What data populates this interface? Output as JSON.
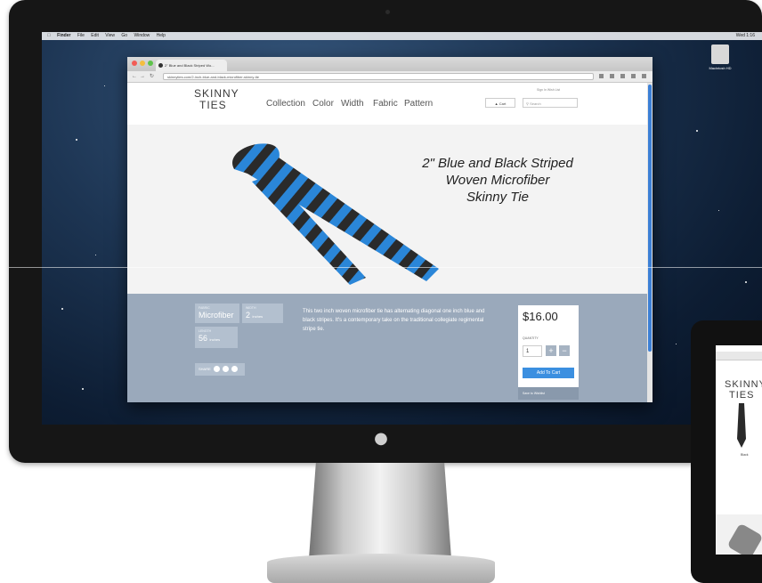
{
  "os": {
    "menubar": {
      "apple_icon": "apple-menu-icon",
      "items": [
        "Finder",
        "File",
        "Edit",
        "View",
        "Go",
        "Window",
        "Help"
      ],
      "clock": "Wed 1:16"
    },
    "desktop_icon_label": "Macintosh HD"
  },
  "browser": {
    "tab_title": "2\" Blue and Black Striped Wo...",
    "url": "skinnyties.com/2-inch-blue-and-black-microfiber-skinny-tie"
  },
  "site": {
    "logo": {
      "line1": "SKINNY",
      "line2": "TIES"
    },
    "nav": [
      "Collection",
      "Color",
      "Width",
      "Fabric",
      "Pattern"
    ],
    "top_links": "Sign In   Wish List",
    "cart_label": "Cart",
    "search_placeholder": "Search"
  },
  "product": {
    "title_lines": [
      "2\" Blue and Black Striped",
      "Woven Microfiber",
      "Skinny Tie"
    ],
    "attributes": [
      {
        "label": "FABRIC",
        "value": "Microfiber",
        "unit": ""
      },
      {
        "label": "WIDTH",
        "value": "2",
        "unit": "inches"
      },
      {
        "label": "LENGTH",
        "value": "56",
        "unit": "inches"
      }
    ],
    "share_label": "SHARE",
    "description": "This two inch woven microfiber tie has alternating diagonal one inch blue and black stripes. It's a contemporary take on the traditional collegiate regimental stripe tie.",
    "price": "$16.00",
    "quantity_label": "QUANTITY",
    "quantity": "1",
    "plus": "+",
    "minus": "−",
    "add_to_cart": "Add To Cart",
    "wishlist": "Save to Wishlist"
  },
  "tablet": {
    "logo": {
      "line1": "SKINNY",
      "line2": "TIES"
    },
    "caption": "Black"
  },
  "colors": {
    "stripe_blue": "#2a86d8",
    "stripe_black": "#2a2a2a",
    "detail_bg": "#9aa9bb",
    "add_to_cart_blue": "#3b8fe0"
  }
}
